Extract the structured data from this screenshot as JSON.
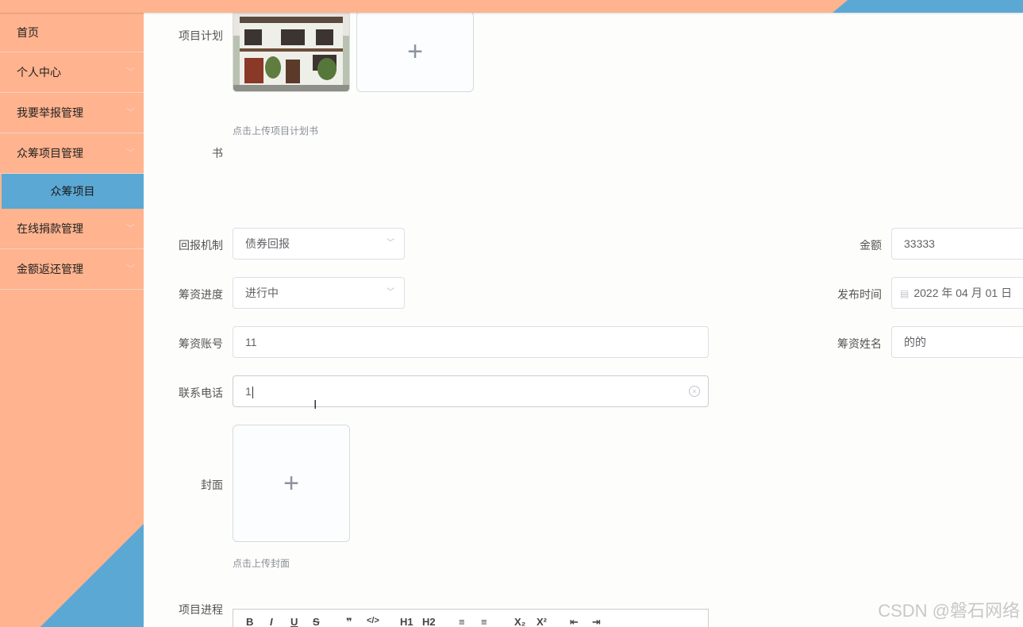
{
  "sidebar": {
    "items": [
      {
        "label": "首页"
      },
      {
        "label": "个人中心"
      },
      {
        "label": "我要举报管理"
      },
      {
        "label": "众筹项目管理"
      },
      {
        "label": "众筹项目"
      },
      {
        "label": "在线捐款管理"
      },
      {
        "label": "金额返还管理"
      }
    ]
  },
  "form": {
    "plan_label_line1": "项目计划",
    "plan_label_line2": "书",
    "plan_tip": "点击上传项目计划书",
    "reward_label": "回报机制",
    "reward_value": "债券回报",
    "amount_label": "金额",
    "amount_value": "33333",
    "progress_label": "筹资进度",
    "progress_value": "进行中",
    "publish_label": "发布时间",
    "publish_value": "2022 年 04 月 01 日",
    "account_label": "筹资账号",
    "account_value": "11",
    "name_label": "筹资姓名",
    "name_value": "的的",
    "phone_label": "联系电话",
    "phone_value": "1",
    "cover_label": "封面",
    "cover_tip": "点击上传封面",
    "process_label": "项目进程"
  },
  "editor_tools": [
    "B",
    "I",
    "U",
    "S",
    "❞",
    "</>",
    "H1",
    "H2",
    "≡",
    "≡",
    "X₂",
    "X²",
    "⇤",
    "⇥"
  ],
  "watermark": "CSDN @磐石网络"
}
